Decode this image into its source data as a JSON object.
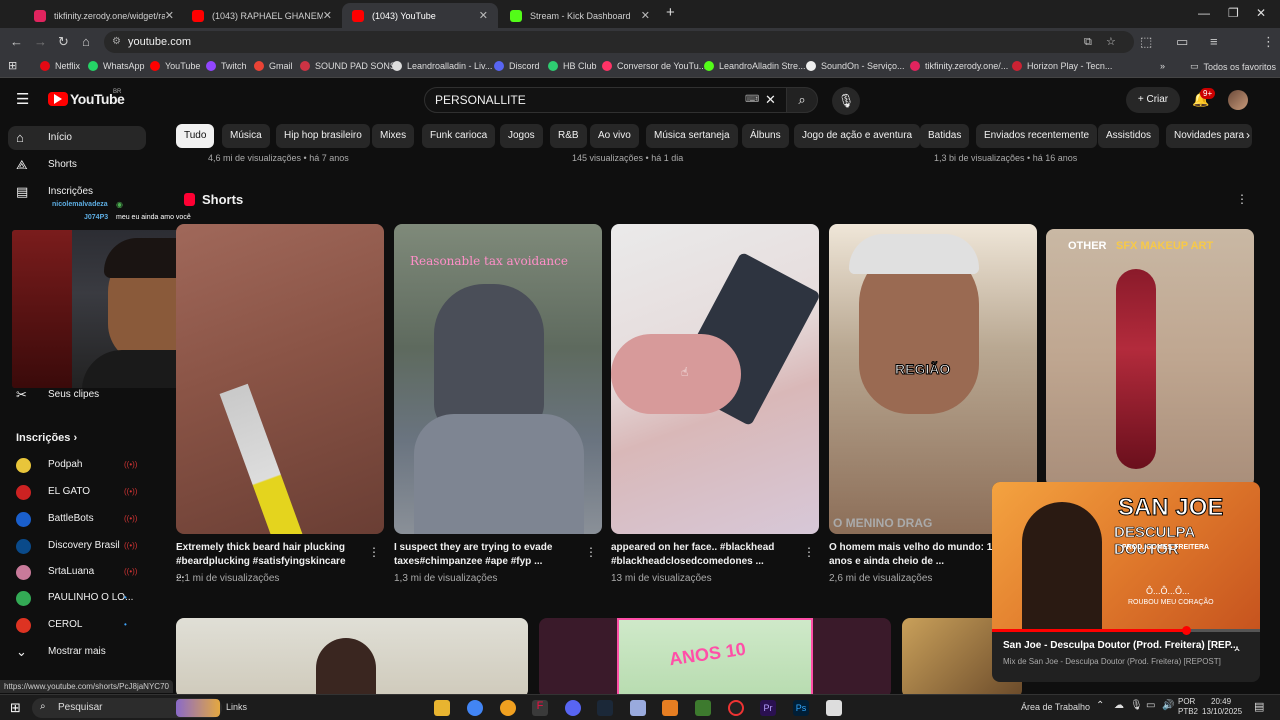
{
  "browser": {
    "tabs": [
      {
        "title": "tikfinity.zerody.one/widget/ran",
        "color": "#e0245e"
      },
      {
        "title": "(1043) RAPHAEL GHANEM BATE",
        "color": "#ff0000"
      },
      {
        "title": "(1043) YouTube",
        "color": "#ff0000"
      },
      {
        "title": "Stream - Kick Dashboard",
        "color": "#53fc18"
      }
    ],
    "url": "youtube.com",
    "bookmarks": [
      {
        "label": "Netflix",
        "color": "#e50914"
      },
      {
        "label": "WhatsApp",
        "color": "#25d366"
      },
      {
        "label": "YouTube",
        "color": "#ff0000"
      },
      {
        "label": "Twitch",
        "color": "#9146ff"
      },
      {
        "label": "Gmail",
        "color": "#ea4335"
      },
      {
        "label": "SOUND PAD SONS",
        "color": "#cc3344"
      },
      {
        "label": "Leandroalladin - Liv...",
        "color": "#dddddd"
      },
      {
        "label": "Discord",
        "color": "#5865f2"
      },
      {
        "label": "HB Club",
        "color": "#2ecc71"
      },
      {
        "label": "Conversor de YouTu...",
        "color": "#ff3366"
      },
      {
        "label": "LeandroAlladin Stre...",
        "color": "#53fc18"
      },
      {
        "label": "SoundOn - Serviço...",
        "color": "#eeeeee"
      },
      {
        "label": "tikfinity.zerody.one/...",
        "color": "#e0245e"
      },
      {
        "label": "Horizon Play - Tecn...",
        "color": "#cc2233"
      }
    ],
    "all_bookmarks": "Todos os favoritos",
    "status_url": "https://www.youtube.com/shorts/PcJ8jaNYC70"
  },
  "youtube": {
    "logo": "YouTube",
    "region": "BR",
    "search_value": "PERSONALLITE",
    "create_label": "Criar",
    "notif_count": "9+",
    "chips": [
      "Tudo",
      "Música",
      "Hip hop brasileiro",
      "Mixes",
      "Funk carioca",
      "Jogos",
      "R&B",
      "Ao vivo",
      "Música sertaneja",
      "Álbuns",
      "Jogo de ação e aventura",
      "Batidas",
      "Enviados recentemente",
      "Assistidos",
      "Novidades para"
    ],
    "sidebar": {
      "home": "Início",
      "shorts": "Shorts",
      "subs": "Inscrições",
      "clips": "Seus clipes",
      "subs_header": "Inscrições",
      "channels": [
        {
          "name": "Podpah",
          "color": "#e8c53a"
        },
        {
          "name": "EL GATO",
          "color": "#cc2222"
        },
        {
          "name": "BattleBots",
          "color": "#1a5fcc"
        },
        {
          "name": "Discovery Brasil",
          "color": "#0a4a8a"
        },
        {
          "name": "SrtaLuana",
          "color": "#c87a9a"
        },
        {
          "name": "PAULINHO O LO...",
          "color": "#33aa55"
        },
        {
          "name": "CEROL",
          "color": "#dd3322"
        }
      ],
      "more": "Mostrar mais"
    },
    "chat_overlay": {
      "user1": "nicolemalvadeza",
      "user2": "J074P3",
      "message": "meu eu ainda amo você"
    },
    "top_meta": [
      "4,6 mi de visualizações • há 7 anos",
      "145 visualizações • há 1 dia",
      "1,3 bi de visualizações • há 16 anos"
    ],
    "shorts_header": "Shorts",
    "shorts": [
      {
        "title1": "Extremely thick beard hair plucking",
        "title2": "#beardplucking #satisfyingskincare ...",
        "views": "2,1 mi de visualizações"
      },
      {
        "title1": "I suspect they are trying to evade",
        "title2": "taxes#chimpanzee #ape #fyp ...",
        "views": "1,3 mi de visualizações",
        "overlay": "Reasonable tax avoidance"
      },
      {
        "title1": "appeared on her face.. #blackhead",
        "title2": "#blackheadclosedcomedones ...",
        "views": "13 mi de visualizações"
      },
      {
        "title1": "O homem mais velho do mundo: 1",
        "title2": "anos e ainda cheio de ...",
        "views": "2,6 mi de visualizações",
        "overlay": "REGIÃO",
        "overlay_bottom": "O MENINO DRAG"
      },
      {
        "title1": "",
        "title2": "",
        "views": "",
        "overlay_a": "OTHER",
        "overlay_b": "SFX MAKEUP ART"
      }
    ],
    "mini_player": {
      "title": "San Joe - Desculpa Doutor (Prod. Freitera) [REP...",
      "subtitle": "Mix de San Joe - Desculpa Doutor (Prod. Freitera) [REPOST]",
      "art_line1": "SAN JOE",
      "art_line2": "DESCULPA DOUTOR",
      "art_line3": "PROD. GOMES FREITERA",
      "art_line4": "Ô...Ô...Ô...",
      "art_line5": "ROUBOU MEU CORAÇÃO"
    },
    "bottom_thumb_text": "ANOS 10"
  },
  "taskbar": {
    "search": "Pesquisar",
    "links": "Links",
    "desktop": "Área de Trabalho",
    "lang1": "POR",
    "lang2": "PTB2",
    "time": "20:49",
    "date": "13/10/2025"
  }
}
